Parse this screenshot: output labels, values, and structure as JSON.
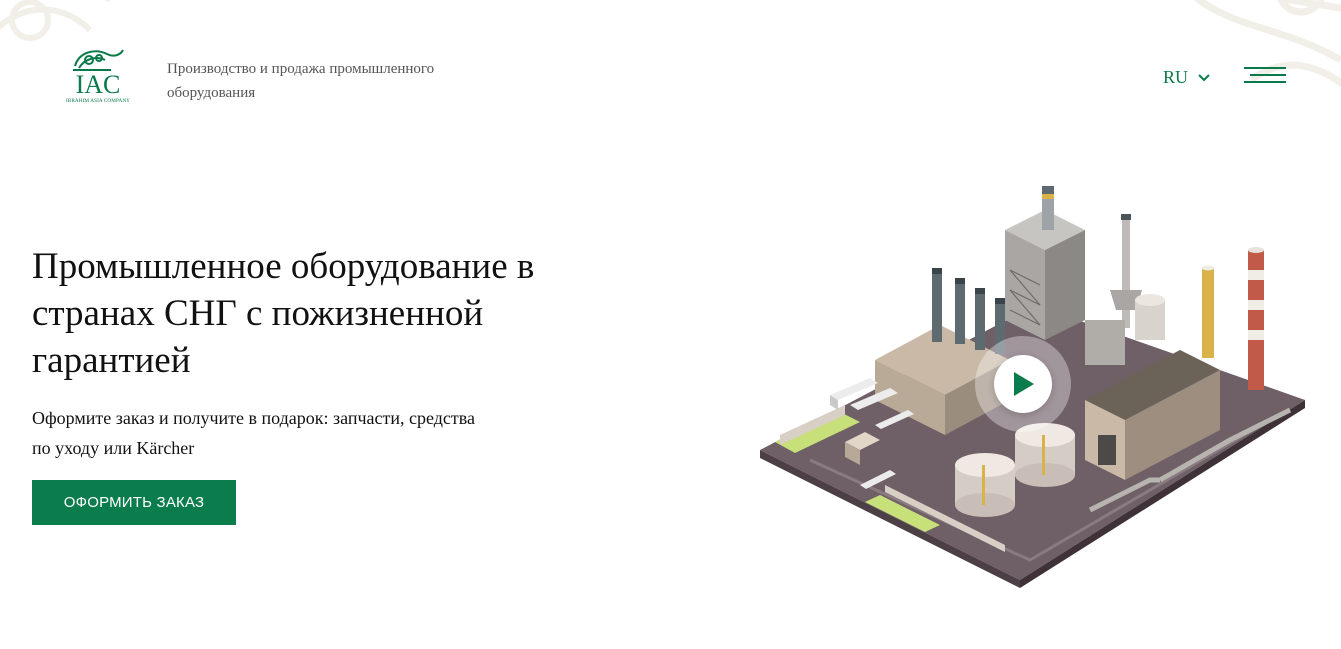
{
  "header": {
    "logo": {
      "mark": "IAC",
      "subtitle": "IBRAHIM ASIA COMPANY",
      "icon": "ornament-leaf-icon"
    },
    "tagline": "Производство и продажа промышленного оборудования",
    "language": {
      "selected": "RU",
      "icon": "chevron-down-icon"
    },
    "menu_icon": "hamburger-menu-icon"
  },
  "hero": {
    "title": "Промышленное оборудование в странах СНГ с пожизненной гарантией",
    "subtitle": "Оформите заказ и получите в подарок: запчасти, средства по уходу или Kärcher",
    "cta_label": "ОФОРМИТЬ ЗАКАЗ",
    "play_icon": "play-icon",
    "illustration": "isometric-factory-illustration"
  },
  "colors": {
    "brand": "#0b7d4c",
    "text": "#111111",
    "muted": "#555555"
  }
}
